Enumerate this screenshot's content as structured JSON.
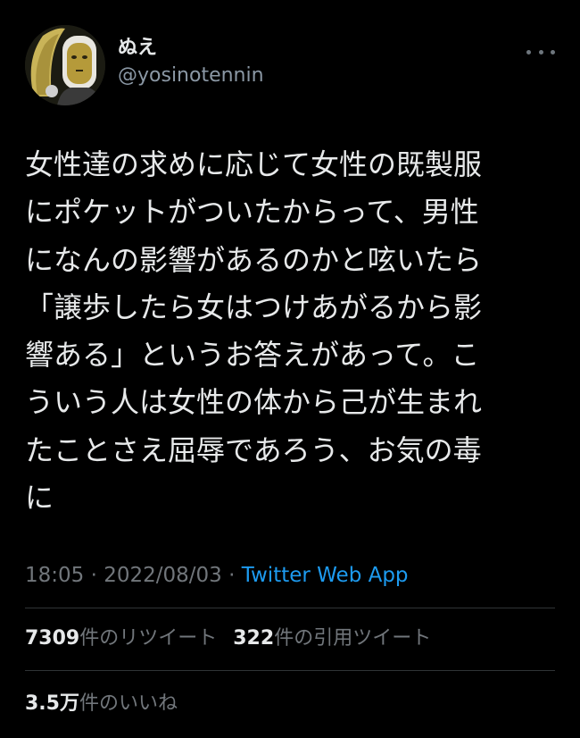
{
  "user": {
    "display_name": "ぬえ",
    "handle": "@yosinotennin"
  },
  "tweet": {
    "lines": [
      "女性達の求めに応じて女性の既製服",
      "にポケットがついたからって、男性",
      "になんの影響があるのかと呟いたら",
      "「譲歩したら女はつけあがるから影",
      "響ある」というお答えがあって。こ",
      "ういう人は女性の体から己が生まれ",
      "たことさえ屈辱であろう、お気の毒",
      "に"
    ]
  },
  "meta": {
    "time": "18:05",
    "sep1": " · ",
    "date": "2022/08/03",
    "sep2": " · ",
    "source": "Twitter Web App"
  },
  "stats": {
    "retweets_count": "7309",
    "retweets_label": "件のリツイート",
    "quotes_count": "322",
    "quotes_label": "件の引用ツイート",
    "likes_count": "3.5万",
    "likes_label": "件のいいね"
  },
  "colors": {
    "background": "#000000",
    "text": "#e7e9ea",
    "secondary": "#71767b",
    "link": "#1d9bf0",
    "divider": "#2f3336"
  },
  "icons": {
    "more": "more-horizontal-icon",
    "avatar": "profile-avatar-image"
  }
}
